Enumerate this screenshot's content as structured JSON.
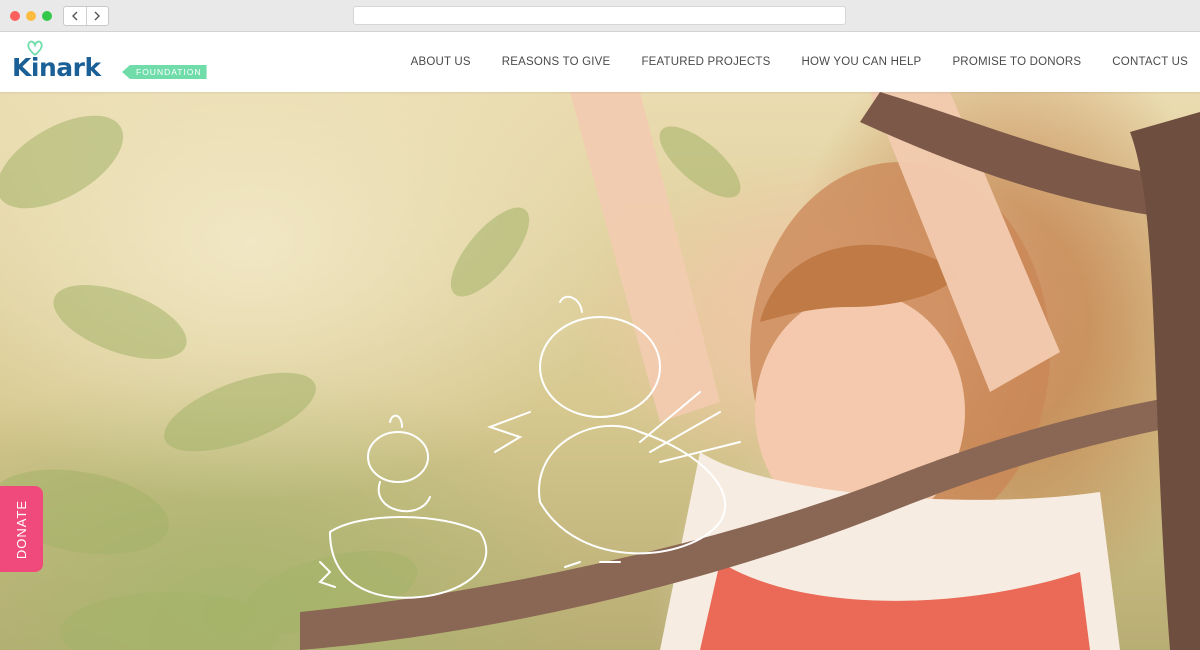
{
  "browser": {
    "back_icon": "chevron-left",
    "forward_icon": "chevron-right",
    "address": ""
  },
  "site": {
    "logo_word": "Kinark",
    "logo_tag": "FOUNDATION",
    "nav": [
      "ABOUT US",
      "REASONS TO GIVE",
      "FEATURED PROJECTS",
      "HOW YOU CAN HELP",
      "PROMISE TO DONORS",
      "CONTACT US"
    ]
  },
  "donate_label": "DONATE",
  "colors": {
    "brand_blue": "#1a5f96",
    "brand_green": "#6fdcaa",
    "donate_pink": "#f04a7c"
  },
  "hero": {
    "illustration": "girl-in-tree-photo-with-chick-doodles"
  }
}
